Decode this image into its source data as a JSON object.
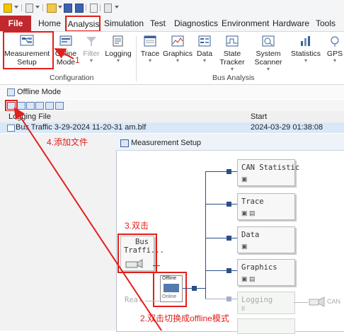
{
  "ribbon": {
    "tabs": [
      {
        "label": "File"
      },
      {
        "label": "Home"
      },
      {
        "label": "Analysis"
      },
      {
        "label": "Simulation"
      },
      {
        "label": "Test"
      },
      {
        "label": "Diagnostics"
      },
      {
        "label": "Environment"
      },
      {
        "label": "Hardware"
      },
      {
        "label": "Tools"
      }
    ],
    "configuration": {
      "group_label": "Configuration",
      "measurement_setup": {
        "line1": "Measurement",
        "line2": "Setup"
      },
      "offline_mode": {
        "line1": "Offline",
        "line2": "Mode"
      },
      "filter": {
        "label": "Filter"
      },
      "logging": {
        "label": "Logging"
      }
    },
    "bus_analysis": {
      "group_label": "Bus Analysis",
      "trace": "Trace",
      "graphics": "Graphics",
      "data": "Data",
      "state_tracker": {
        "line1": "State",
        "line2": "Tracker"
      },
      "system_scanner": {
        "line1": "System",
        "line2": "Scanner"
      },
      "statistics": "Statistics",
      "gps": "GPS"
    }
  },
  "offline_mode_window": {
    "title": "Offline Mode",
    "columns": {
      "file": "Logging File",
      "start": "Start"
    },
    "rows": [
      {
        "file": "Bus Traffic 3-29-2024 11-20-31 am.blf",
        "start": "2024-03-29 01:38:08"
      }
    ]
  },
  "measurement_setup": {
    "title": "Measurement Setup",
    "source_block": {
      "line1": "Bus",
      "line2": "Traffi..."
    },
    "switch": {
      "top": "Offline",
      "bottom": "Online"
    },
    "real_label": "Real",
    "blocks": [
      {
        "label": "CAN Statistic"
      },
      {
        "label": "Trace"
      },
      {
        "label": "Data"
      },
      {
        "label": "Graphics"
      },
      {
        "label": "Logging",
        "pause": "II"
      }
    ],
    "can_label": "CAN"
  },
  "annotations": {
    "step1": "1",
    "step2": "2.双击切换成offline模式",
    "step3": "3.双击",
    "step4": "4.添加文件"
  },
  "colors": {
    "accent": "#c0282d",
    "annotation": "#e0201c",
    "node": "#2a4f86"
  }
}
